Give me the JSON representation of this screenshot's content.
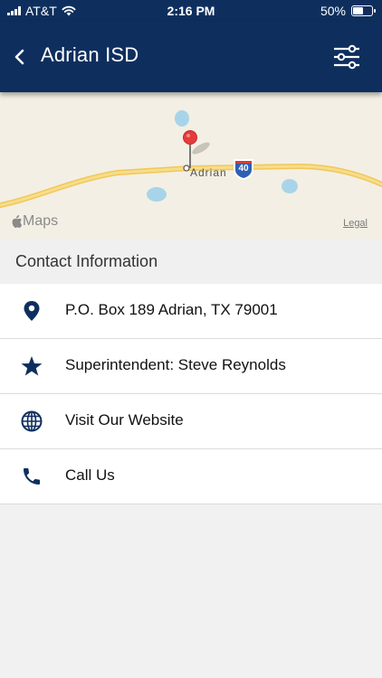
{
  "status_bar": {
    "carrier": "AT&T",
    "time": "2:16 PM",
    "battery": "50%"
  },
  "nav": {
    "title": "Adrian ISD",
    "back_icon": "chevron-left-icon",
    "filter_icon": "sliders-icon"
  },
  "map": {
    "town_label": "Adrian",
    "highway_label": "40",
    "attribution": "Maps",
    "legal": "Legal"
  },
  "section": {
    "title": "Contact Information"
  },
  "contacts": [
    {
      "icon": "map-pin-icon",
      "label": "P.O. Box 189 Adrian, TX 79001"
    },
    {
      "icon": "star-icon",
      "label": "Superintendent: Steve Reynolds"
    },
    {
      "icon": "globe-icon",
      "label": "Visit Our Website"
    },
    {
      "icon": "phone-icon",
      "label": "Call Us"
    }
  ],
  "colors": {
    "nav_background": "#0e2f5e",
    "icon_color": "#0e2f5e",
    "page_background": "#f1f1f1"
  }
}
